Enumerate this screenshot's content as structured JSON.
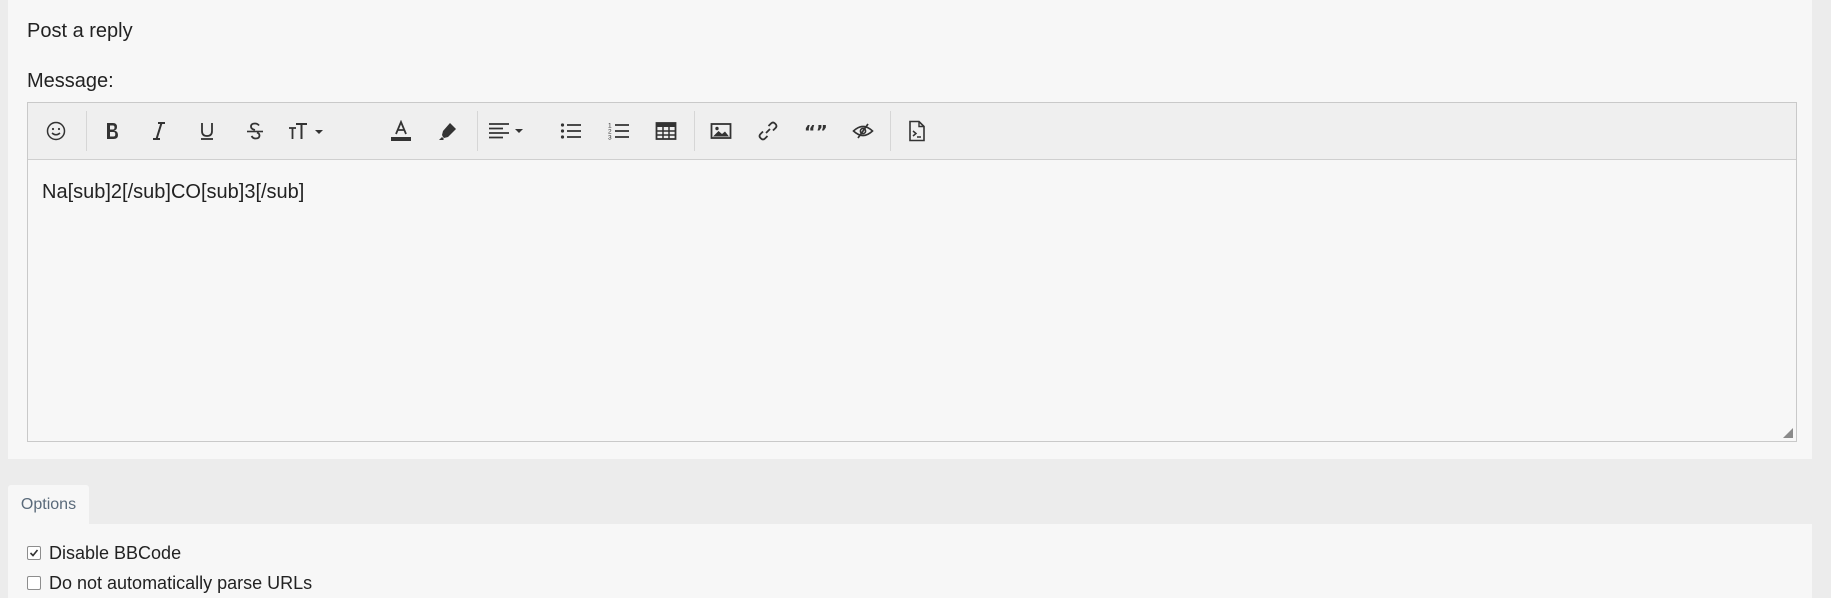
{
  "post": {
    "title": "Post a reply",
    "message_label": "Message:"
  },
  "toolbar": {
    "buttons": [
      {
        "name": "emoji-button",
        "icon": "smiley-icon"
      },
      {
        "name": "bold-button",
        "icon": "bold-icon"
      },
      {
        "name": "italic-button",
        "icon": "italic-icon"
      },
      {
        "name": "underline-button",
        "icon": "underline-icon"
      },
      {
        "name": "strikethrough-button",
        "icon": "strikethrough-icon"
      },
      {
        "name": "font-size-dropdown",
        "icon": "text-size-icon"
      },
      {
        "name": "font-color-button",
        "icon": "font-color-icon"
      },
      {
        "name": "highlight-button",
        "icon": "highlighter-icon"
      },
      {
        "name": "align-dropdown",
        "icon": "align-left-icon"
      },
      {
        "name": "bullet-list-button",
        "icon": "bullet-list-icon"
      },
      {
        "name": "numbered-list-button",
        "icon": "numbered-list-icon"
      },
      {
        "name": "table-button",
        "icon": "table-icon"
      },
      {
        "name": "image-button",
        "icon": "image-icon"
      },
      {
        "name": "link-button",
        "icon": "link-icon"
      },
      {
        "name": "quote-button",
        "icon": "quote-icon"
      },
      {
        "name": "spoiler-button",
        "icon": "eye-slash-icon"
      },
      {
        "name": "source-button",
        "icon": "code-file-icon"
      }
    ]
  },
  "editor": {
    "content": "Na[sub]2[/sub]CO[sub]3[/sub]"
  },
  "options": {
    "tab_label": "Options",
    "items": [
      {
        "label": "Disable BBCode",
        "checked": true
      },
      {
        "label": "Do not automatically parse URLs",
        "checked": false
      }
    ]
  },
  "colors": {
    "page_bg": "#ececec",
    "panel_bg": "#f7f7f7",
    "toolbar_bg": "#efefef",
    "border": "#c9c9c9",
    "icon": "#333333",
    "tab_text": "#5a6a7a"
  }
}
